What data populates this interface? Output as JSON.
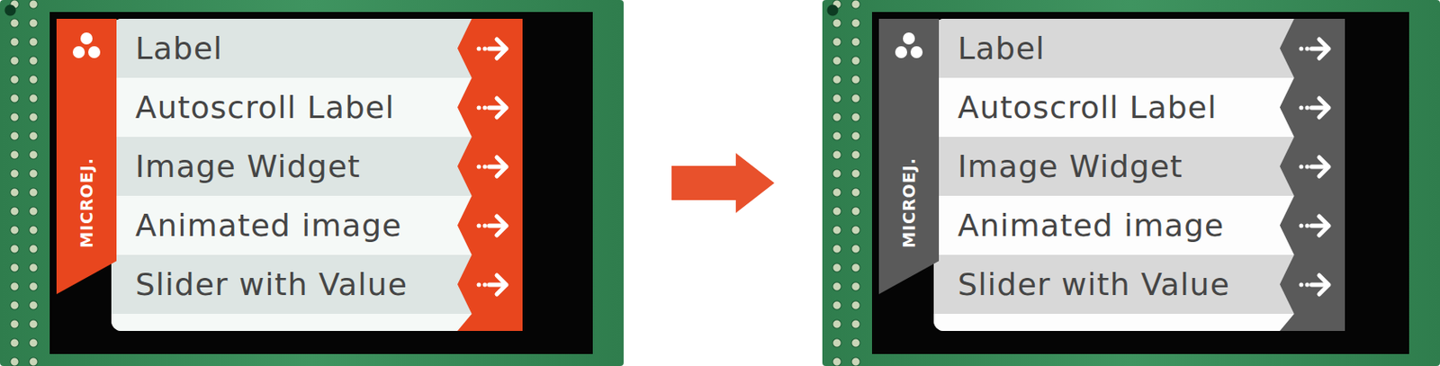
{
  "panels": [
    {
      "kind": "color",
      "color": "#e8461e",
      "brand": "MICROEJ.",
      "items": [
        {
          "label": "Label"
        },
        {
          "label": "Autoscroll Label"
        },
        {
          "label": "Image Widget"
        },
        {
          "label": "Animated image"
        },
        {
          "label": "Slider with Value"
        }
      ]
    },
    {
      "kind": "grayscale",
      "color": "#5a5a5a",
      "brand": "MICROEJ.",
      "items": [
        {
          "label": "Label"
        },
        {
          "label": "Autoscroll Label"
        },
        {
          "label": "Image Widget"
        },
        {
          "label": "Animated image"
        },
        {
          "label": "Slider with Value"
        }
      ]
    }
  ]
}
